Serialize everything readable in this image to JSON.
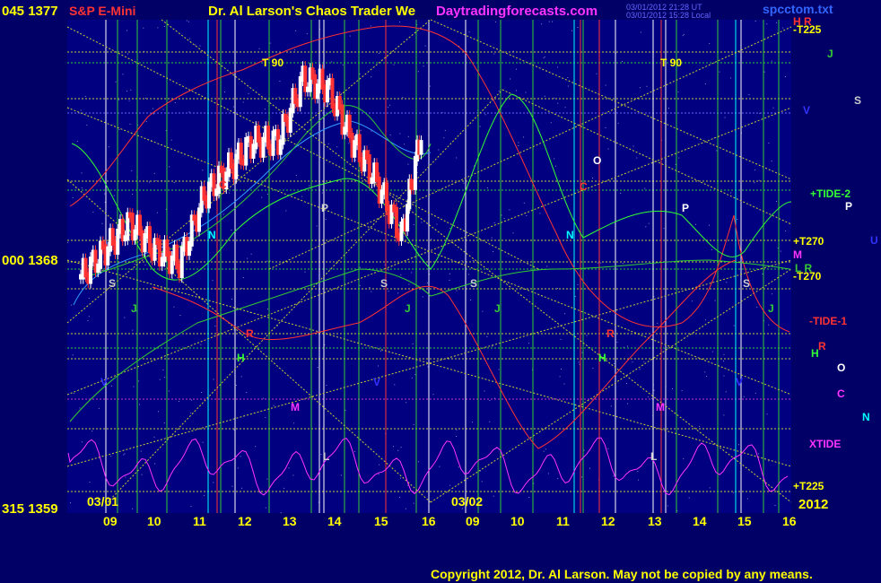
{
  "header": {
    "left_price_label": "045 1377",
    "symbol": "S&P E-Mini",
    "title": "Dr. Al Larson's Chaos Trader We",
    "site": "Daytradingforecasts.com",
    "timestamp_1": "03/01/2012 21:28 UT",
    "timestamp_2": "03/01/2012 15:28 Local",
    "file": "spcctom.txt"
  },
  "y_axis": {
    "mid_label": "000 1368",
    "bottom_label": "315 1359"
  },
  "dates": {
    "day1": "03/01",
    "day2": "03/02",
    "year": "2012"
  },
  "x_ticks": [
    "09",
    "10",
    "11",
    "12",
    "13",
    "14",
    "15",
    "16",
    "09",
    "10",
    "11",
    "12",
    "13",
    "14",
    "15",
    "16"
  ],
  "right_labels": [
    {
      "text": "H  R",
      "color": "#ff3333"
    },
    {
      "text": "-T225",
      "color": "#ffff00"
    },
    {
      "text": "J",
      "color": "#33cc33"
    },
    {
      "text": "S",
      "color": "#cccccc"
    },
    {
      "text": "V",
      "color": "#3333ff"
    },
    {
      "text": "+TIDE-2",
      "color": "#33ff33"
    },
    {
      "text": "P",
      "color": "#ffffff"
    },
    {
      "text": "+T270",
      "color": "#ffff00"
    },
    {
      "text": "U",
      "color": "#3333ff"
    },
    {
      "text": "M",
      "color": "#ff33ff"
    },
    {
      "text": "L R",
      "color": "#33cc33"
    },
    {
      "text": "-T270",
      "color": "#ffff00"
    },
    {
      "text": "-TIDE-1",
      "color": "#ff3333"
    },
    {
      "text": "R",
      "color": "#ff3333"
    },
    {
      "text": "H",
      "color": "#33ff33"
    },
    {
      "text": "O",
      "color": "#ffffff"
    },
    {
      "text": "C",
      "color": "#ff33ff"
    },
    {
      "text": "N",
      "color": "#00ffff"
    },
    {
      "text": "XTIDE",
      "color": "#ff33ff"
    },
    {
      "text": "+T225",
      "color": "#ffff00"
    }
  ],
  "plot_labels": [
    {
      "text": "T  90",
      "color": "#ffff00"
    },
    {
      "text": "T  90",
      "color": "#ffff00"
    },
    {
      "text": "O",
      "color": "#ffffff"
    },
    {
      "text": "C",
      "color": "#ff3333"
    },
    {
      "text": "N",
      "color": "#00ffff"
    },
    {
      "text": "N",
      "color": "#00ffff"
    },
    {
      "text": "P",
      "color": "#cccccc"
    },
    {
      "text": "P",
      "color": "#ffffff"
    },
    {
      "text": "S",
      "color": "#cccccc"
    },
    {
      "text": "S",
      "color": "#cccccc"
    },
    {
      "text": "S",
      "color": "#cccccc"
    },
    {
      "text": "S",
      "color": "#cccccc"
    },
    {
      "text": "J",
      "color": "#33cc33"
    },
    {
      "text": "J",
      "color": "#33cc33"
    },
    {
      "text": "J",
      "color": "#33cc33"
    },
    {
      "text": "J",
      "color": "#33cc33"
    },
    {
      "text": "R",
      "color": "#ff3333"
    },
    {
      "text": "R",
      "color": "#ff3333"
    },
    {
      "text": "H",
      "color": "#33ff33"
    },
    {
      "text": "H",
      "color": "#33ff33"
    },
    {
      "text": "M",
      "color": "#ff33ff"
    },
    {
      "text": "M",
      "color": "#ff33ff"
    },
    {
      "text": "V",
      "color": "#3333ff"
    },
    {
      "text": "V",
      "color": "#3333ff"
    },
    {
      "text": "V",
      "color": "#3333ff"
    },
    {
      "text": "L",
      "color": "#cccccc"
    },
    {
      "text": "L",
      "color": "#cccccc"
    },
    {
      "text": "C",
      "color": "#ff3333"
    }
  ],
  "copyright": "Copyright 2012, Dr. Al Larson. May not be copied by any means.",
  "chart_data": {
    "type": "line",
    "title": "S&P E-Mini",
    "ylim": [
      1359,
      1377
    ],
    "y_ticks": [
      1359,
      1368,
      1377
    ],
    "series": [
      {
        "name": "S&P E-Mini",
        "color": "#ffffff",
        "x": [
          9.0,
          9.5,
          10.0,
          10.5,
          11.0,
          11.5,
          12.0,
          12.5,
          13.0,
          13.5,
          14.0,
          14.5,
          15.0,
          15.5,
          15.9
        ],
        "y": [
          1367.5,
          1368.5,
          1369.5,
          1368.5,
          1368.0,
          1370.5,
          1371.5,
          1372.5,
          1372.5,
          1374.8,
          1374.5,
          1372.5,
          1371.0,
          1369.0,
          1372.8
        ]
      },
      {
        "name": "-TIDE-1",
        "color": "#ff3333"
      },
      {
        "name": "+TIDE-2",
        "color": "#33ff33"
      },
      {
        "name": "XTIDE",
        "color": "#ff33ff"
      }
    ]
  },
  "colors": {
    "background": "#000066",
    "plot_bg": "#000080",
    "grid_yellow": "#cccc33",
    "grid_green": "#33cc33",
    "text_yellow": "#ffff00",
    "text_red": "#ff3333",
    "text_magenta": "#ff33ff"
  }
}
